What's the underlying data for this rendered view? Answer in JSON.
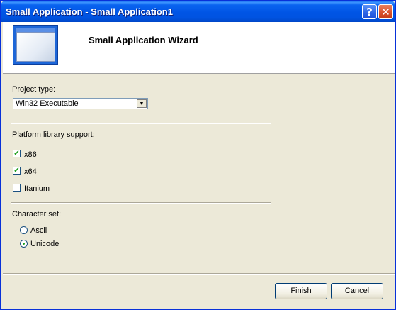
{
  "window": {
    "title": "Small Application - Small Application1",
    "help_glyph": "?",
    "close_glyph": "✕"
  },
  "header": {
    "title": "Small Application Wizard",
    "icon": "application-window-icon"
  },
  "project_type": {
    "label": "Project type:",
    "selected": "Win32 Executable",
    "arrow_glyph": "▼"
  },
  "platform": {
    "label": "Platform library support:",
    "options": [
      {
        "label": "x86",
        "checked": true,
        "mark": "✔"
      },
      {
        "label": "x64",
        "checked": true,
        "mark": "✔"
      },
      {
        "label": "Itanium",
        "checked": false,
        "mark": ""
      }
    ]
  },
  "charset": {
    "label": "Character set:",
    "options": [
      {
        "label": "Ascii",
        "selected": false
      },
      {
        "label": "Unicode",
        "selected": true
      }
    ]
  },
  "buttons": {
    "finish_mnemonic": "F",
    "finish_rest": "inish",
    "cancel_mnemonic": "C",
    "cancel_rest": "ancel"
  },
  "colors": {
    "titlebar": "#0055e5",
    "dialog_bg": "#ece9d8",
    "check_mark": "#21a121"
  }
}
